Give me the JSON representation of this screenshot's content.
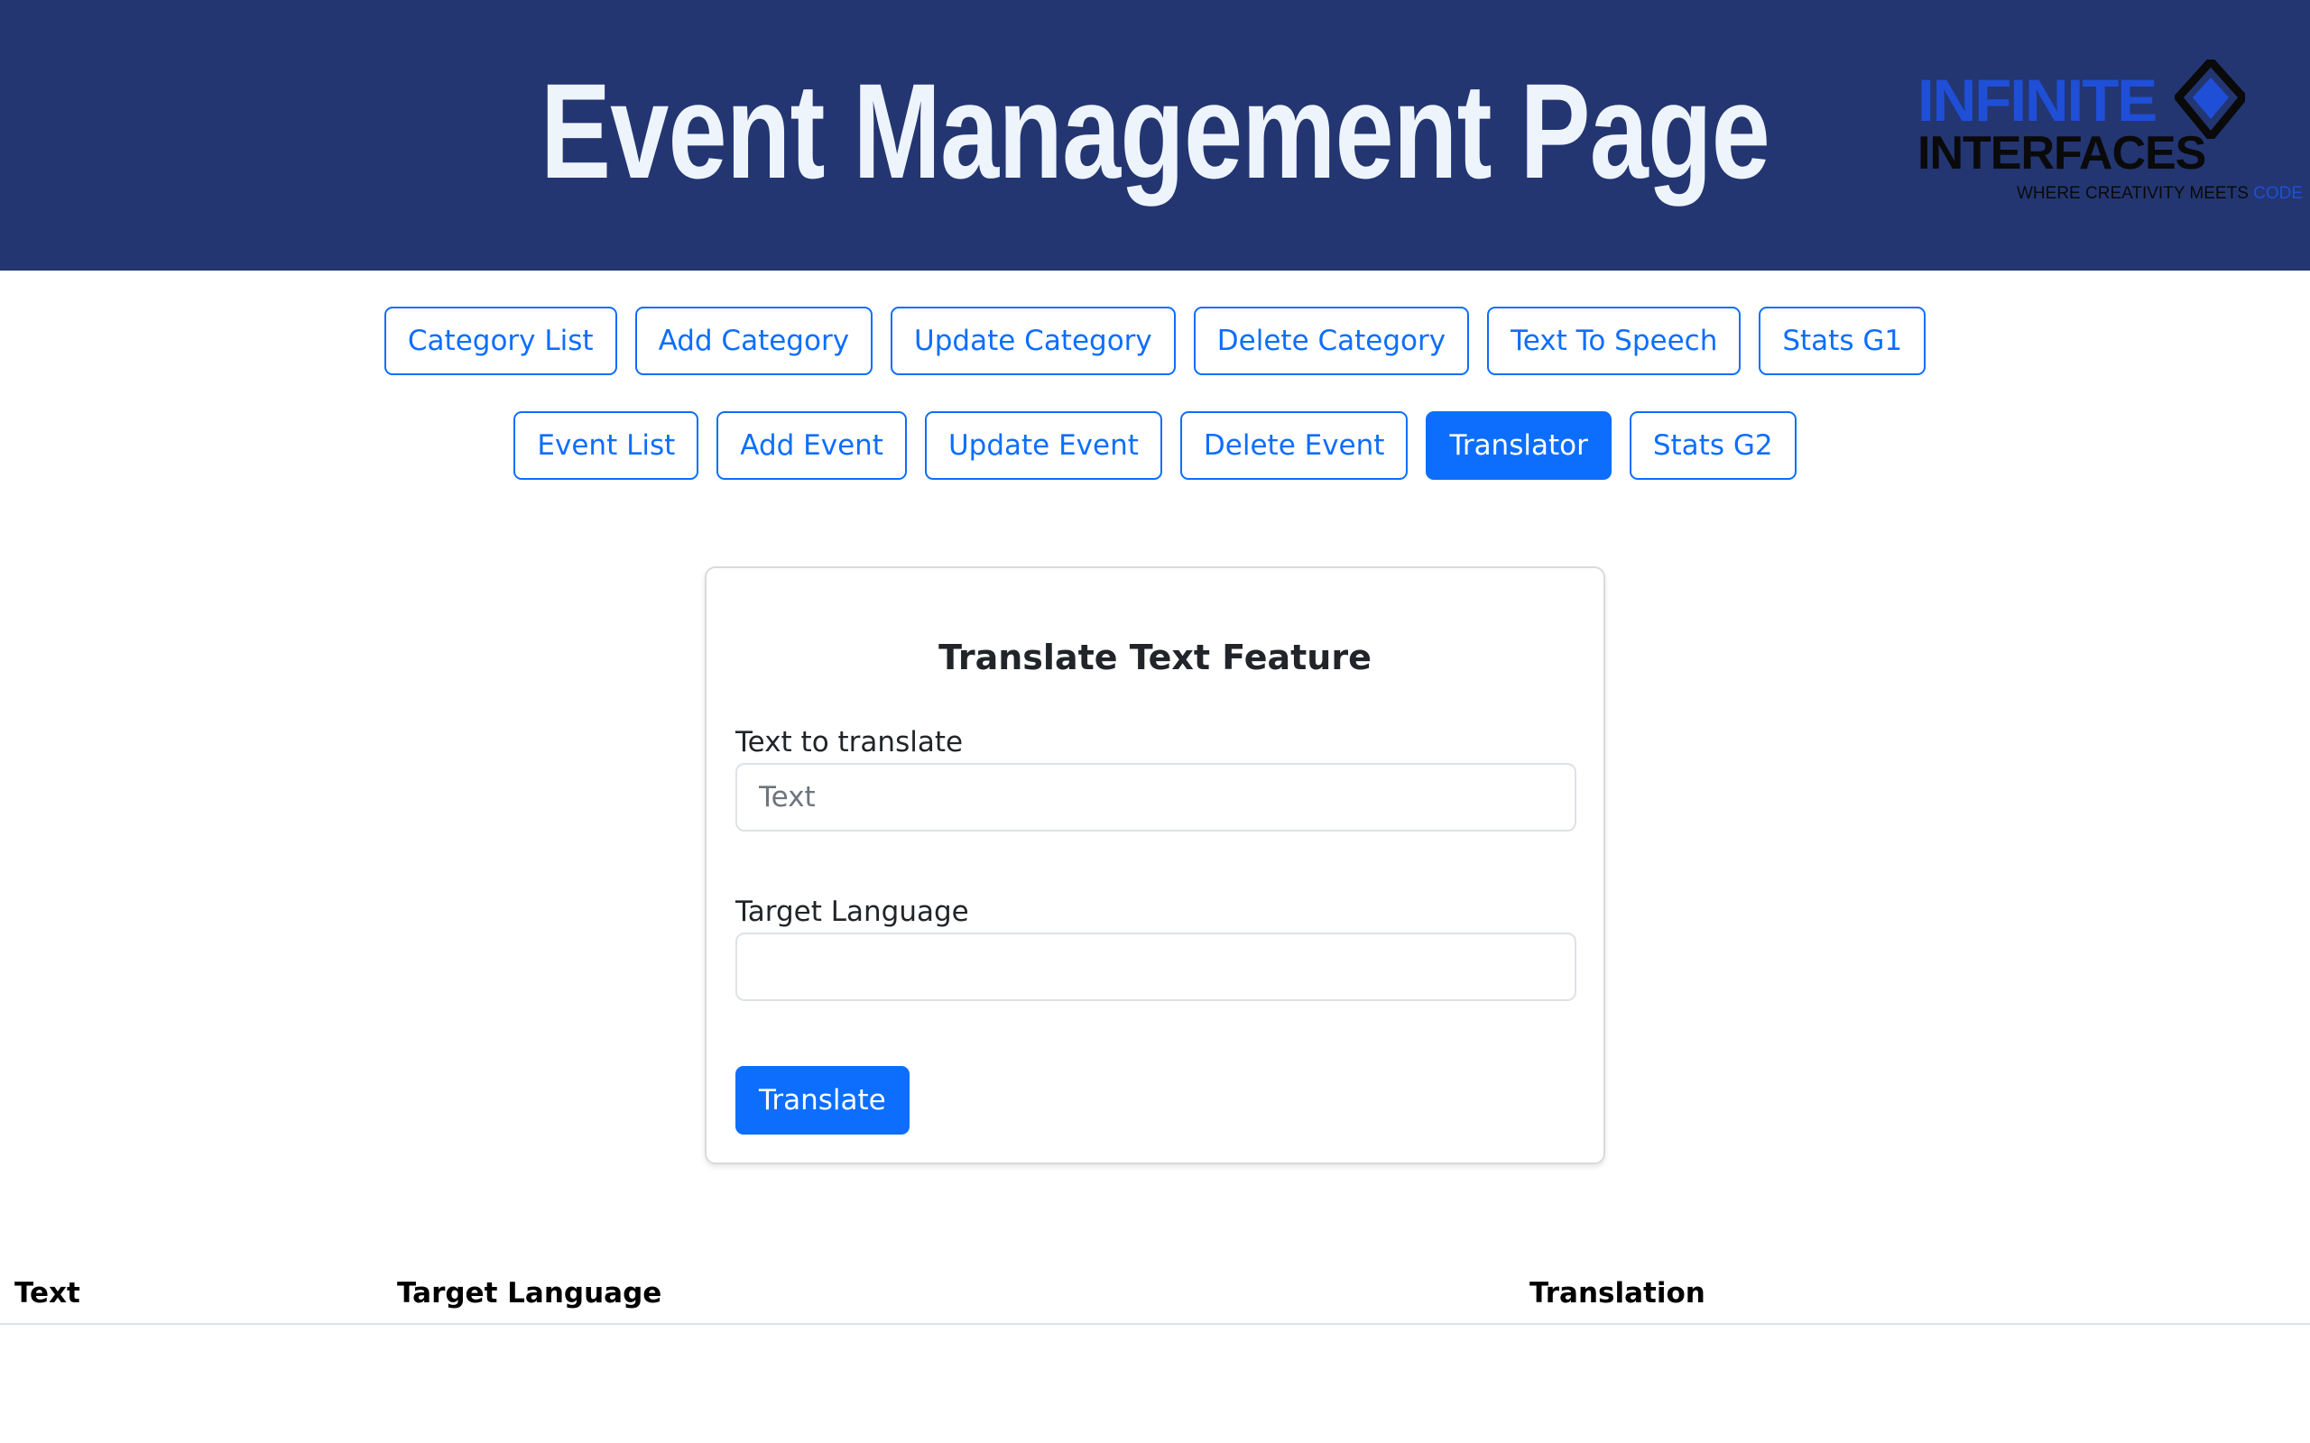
{
  "header": {
    "title": "Event Management Page",
    "background_color": "#233672",
    "logo": {
      "word1": "INFINITE",
      "word2": "INTERFACES",
      "tagline": "WHERE CREATIVITY MEETS",
      "tagline_accent": "CODE",
      "accent_color": "#1f4fd6"
    }
  },
  "nav": {
    "row1": [
      {
        "label": "Category List",
        "active": false
      },
      {
        "label": "Add Category",
        "active": false
      },
      {
        "label": "Update Category",
        "active": false
      },
      {
        "label": "Delete Category",
        "active": false
      },
      {
        "label": "Text To Speech",
        "active": false
      },
      {
        "label": "Stats G1",
        "active": false
      }
    ],
    "row2": [
      {
        "label": "Event List",
        "active": false
      },
      {
        "label": "Add Event",
        "active": false
      },
      {
        "label": "Update Event",
        "active": false
      },
      {
        "label": "Delete Event",
        "active": false
      },
      {
        "label": "Translator",
        "active": true
      },
      {
        "label": "Stats G2",
        "active": false
      }
    ],
    "primary_color": "#0d6efd"
  },
  "form": {
    "title": "Translate Text Feature",
    "text_label": "Text to translate",
    "text_value": "",
    "text_placeholder": "Text",
    "language_label": "Target Language",
    "language_value": "",
    "language_placeholder": "",
    "submit_label": "Translate"
  },
  "table": {
    "headers": [
      "Text",
      "Target Language",
      "Translation"
    ],
    "rows": []
  }
}
